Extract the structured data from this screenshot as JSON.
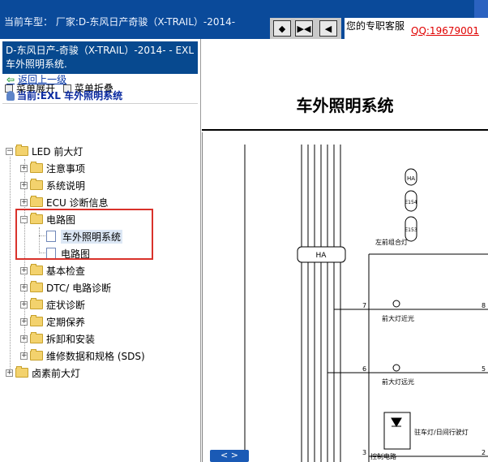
{
  "header": {
    "car_model": "当前车型： 厂家:D-东风日产奇骏（X-TRAIL）-2014-",
    "nav_buttons": [
      "◆",
      "▶◀",
      "◀"
    ],
    "service_label": "您的专职客服",
    "service_qq": "QQ:19679001"
  },
  "sidebar": {
    "title": "D-东风日产-奇骏（X-TRAIL）-2014- - EXL 车外照明系统.",
    "expand_label": "菜单展开",
    "collapse_label": "菜单折叠",
    "back_label": "返回上一级",
    "current_label": "当前:EXL 车外照明系统",
    "tree": {
      "root": "LED 前大灯",
      "items": [
        "注意事项",
        "系统说明",
        "ECU 诊断信息",
        "电路图",
        "基本检查",
        "DTC/ 电路诊断",
        "症状诊断",
        "定期保养",
        "拆卸和安装",
        "维修数据和规格 (SDS)"
      ],
      "circuit_children": [
        "车外照明系统",
        "电路图"
      ],
      "sibling_root": "卤素前大灯"
    }
  },
  "document": {
    "title": "车外照明系统",
    "labels": {
      "connector_ha": "HA",
      "connector_e154": "E154",
      "connector_e153": "E153",
      "combo_lamp": "左前组合灯",
      "headlamp_low": "前大灯近光",
      "headlamp_high": "前大灯远光",
      "parking_lamp": "驻车灯/日间行驶灯",
      "control_circuit": "控制电路",
      "pin_7": "7",
      "pin_6": "6",
      "pin_3": "3",
      "pin_8": "8",
      "pin_5": "5",
      "pin_2": "2"
    },
    "nav_arrows": "< >"
  },
  "colors": {
    "header_bg": "#0a4a9a",
    "title_box_bg": "#07498f",
    "qq_link": "#e00000",
    "highlight": "#d9322b"
  }
}
